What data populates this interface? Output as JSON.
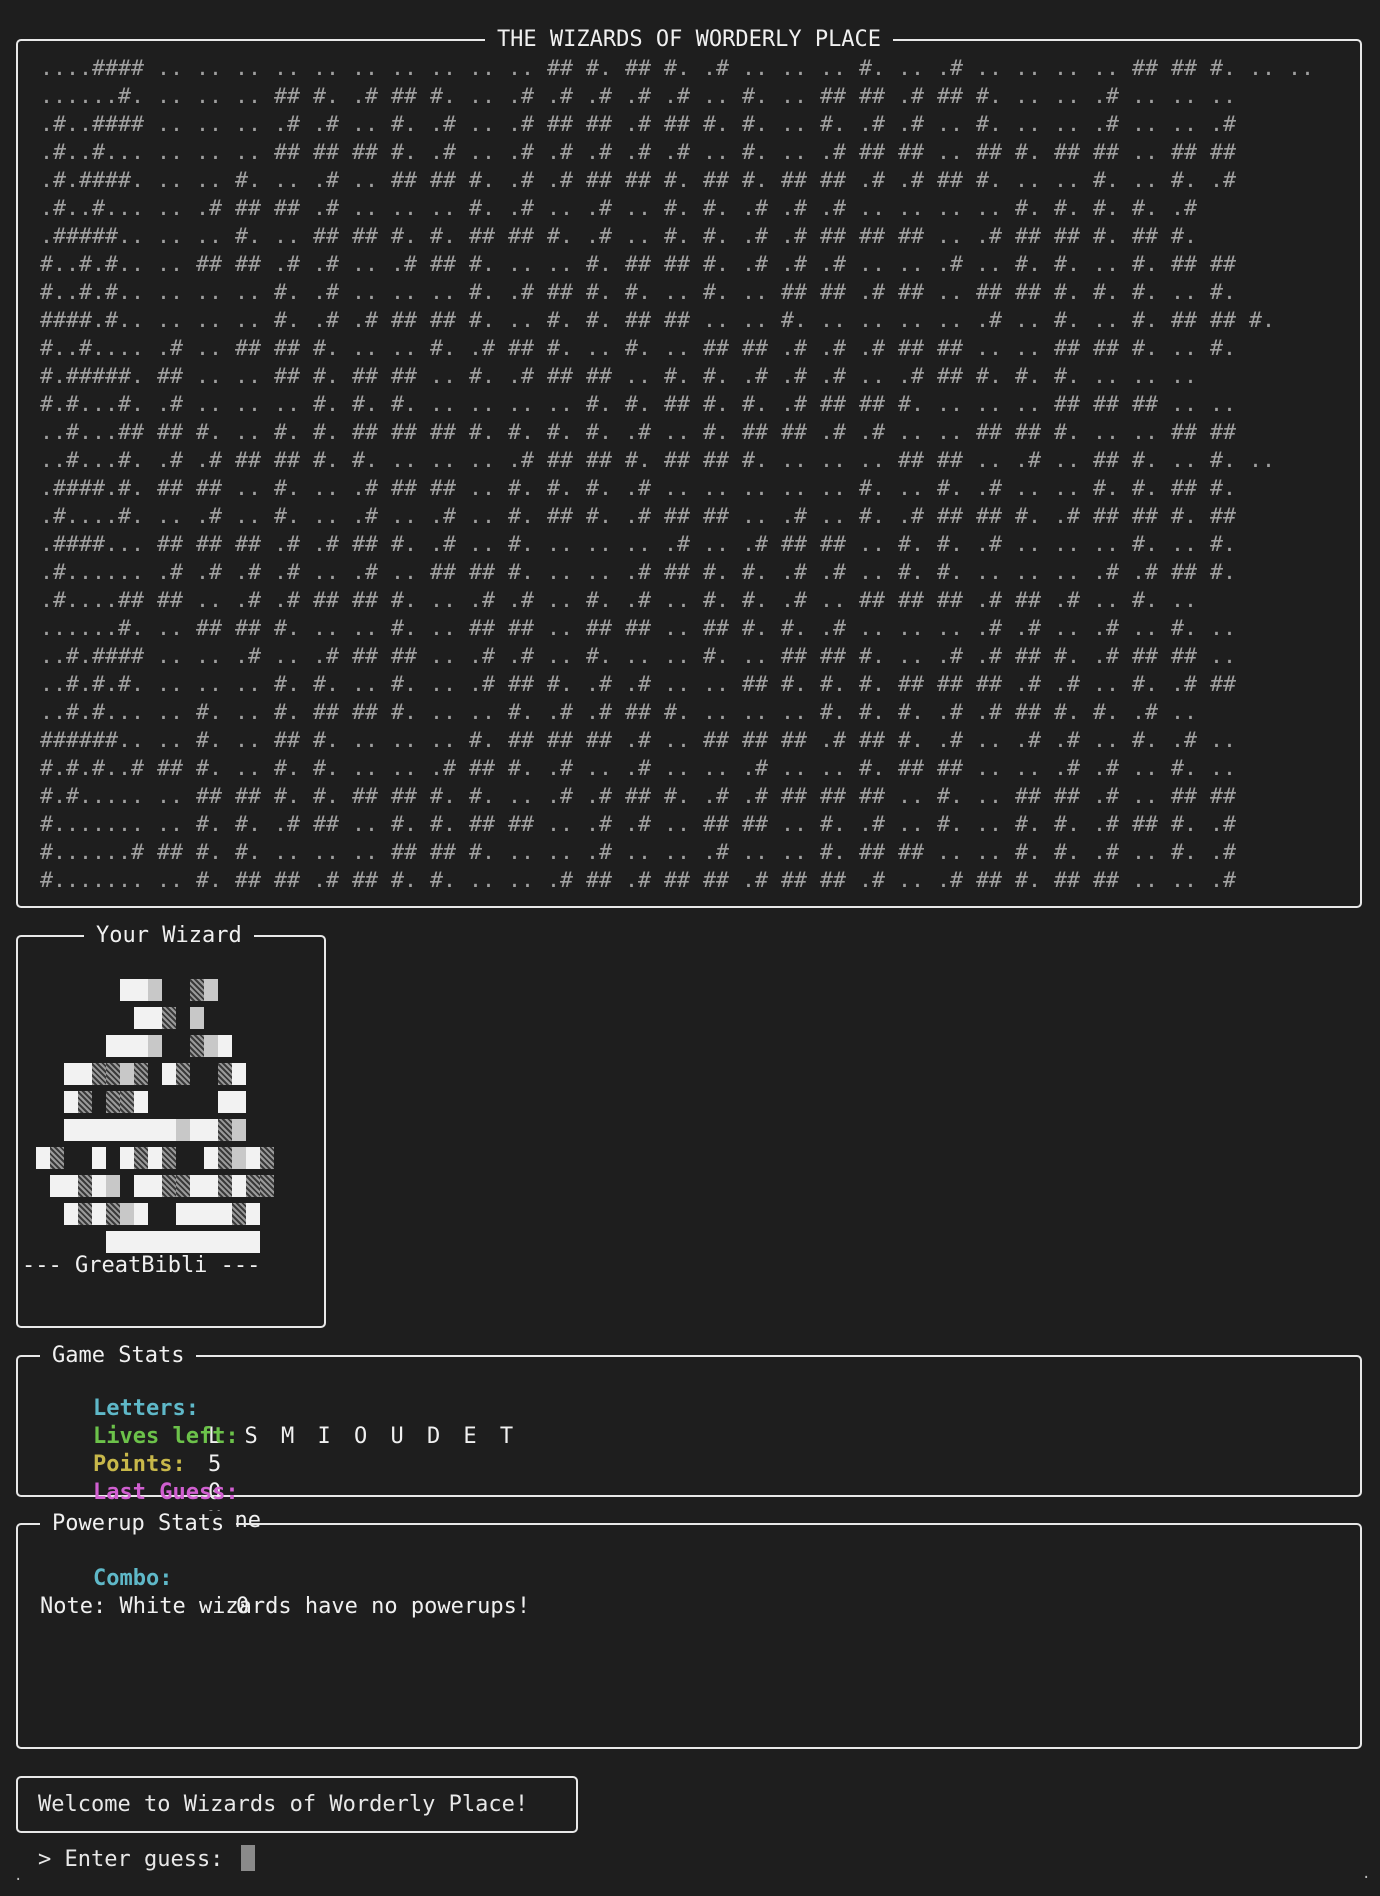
{
  "board": {
    "title": "THE WIZARDS OF WORDERLY PLACE",
    "rows": [
      "....#### .. .. .. .. .. .. .. .. .. .. ## #. ## #. .# .. .. .. #. .. .# .. .. .. .. ## ## #. .. ..",
      "......#. .. .. .. ## #. .# ## #. .. .# .# .# .# .# .. #. .. ## ## .# ## #. .. .. .# .. .. ..",
      ".#..#### .. .. .. .# .# .. #. .# .. .# ## ## .# ## #. #. .. #. .# .# .. #. .. .. .# .. .. .#",
      ".#..#... .. .. .. ## ## ## #. .# .. .# .# .# .# .# .. #. .. .# ## ## .. ## #. ## ## .. ## ##",
      ".#.####. .. .. #. .. .# .. ## ## #. .# .# ## ## #. ## #. ## ## .# .# ## #. .. .. #. .. #. .#",
      ".#..#... .. .# ## ## .# .. .. .. #. .# .. .# .. #. #. .# .# .# .. .. .. .. #. #. #. #. .#",
      ".#####.. .. .. #. .. ## ## #. #. ## ## #. .# .. #. #. .# .# ## ## ## .. .# ## ## #. ## #.",
      "#..#.#.. .. ## ## .# .# .. .# ## #. .. .. #. ## ## #. .# .# .# .. .. .# .. #. #. .. #. ## ##",
      "#..#.#.. .. .. .. #. .# .. .. .. #. .# ## #. #. .. #. .. ## ## .# ## .. ## ## #. #. #. .. #.",
      "####.#.. .. .. .. #. .# .# ## ## #. .. #. #. ## ## .. .. #. .. .. .. .. .# .. #. .. #. ## ## #.",
      "#..#.... .# .. ## ## #. .. .. #. .# ## #. .. #. .. ## ## .# .# .# ## ## .. .. ## ## #. .. #.",
      "#.#####. ## .. .. ## #. ## ## .. #. .# ## ## .. #. #. .# .# .# .. .# ## #. #. #. .. .. ..",
      "#.#...#. .# .. .. .. #. #. #. .. .. .. .. #. #. ## #. #. .# ## ## #. .. .. .. ## ## ## .. ..",
      "..#...## ## #. .. #. #. ## ## ## #. #. #. #. .# .. #. ## ## .# .# .. .. ## ## #. .. .. ## ##",
      "..#...#. .# .# ## ## #. #. .. .. .. .# ## ## #. ## ## #. .. .. .. ## ## .. .# .. ## #. .. #. ..",
      ".####.#. ## ## .. #. .. .# ## ## .. #. #. #. .# .. .. .. .. .. #. .. #. .# .. .. #. #. ## #.",
      ".#....#. .. .# .. #. .. .# .. .# .. #. ## #. .# ## ## .. .# .. #. .# ## ## #. .# ## ## #. ##",
      ".####... ## ## ## .# .# ## #. .# .. #. .. .. .. .# .. .# ## ## .. #. #. .# .. .. .. #. .. #.",
      ".#...... .# .# .# .# .. .# .. ## ## #. .. .. .# ## #. #. .# .# .. #. #. .. .. .. .# .# ## #.",
      ".#....## ## .. .# .# ## ## #. .. .# .# .. #. .# .. #. #. .# .. ## ## ## .# ## .# .. #. ..",
      "......#. .. ## ## #. .. .. #. .. ## ## .. ## ## .. ## #. #. .# .. .. .. .# .# .. .# .. #. ..",
      "..#.#### .. .. .# .. .# ## ## .. .# .# .. #. .. .. #. .. ## ## #. .. .# .# ## #. .# ## ## ..",
      "..#.#.#. .. .. .. #. #. .. #. .. .# ## #. .# .# .. .. ## #. #. #. ## ## ## .# .# .. #. .# ##",
      "..#.#... .. #. .. #. ## ## #. .. .. #. .# .# ## #. .. .. .. #. #. #. .# .# ## #. #. .# ..",
      "######.. .. #. .. ## #. .. .. .. #. ## ## ## .# .. ## ## ## .# ## #. .# .. .# .# .. #. .# ..",
      "#.#.#..# ## #. .. #. #. .. .. .# ## #. .# .. .# .. .. .# .. .. #. ## ## .. .. .# .# .. #. ..",
      "#.#..... .. ## ## #. #. ## ## #. #. .. .# .# ## #. .# .# ## ## ## .. #. .. ## ## .# .. ## ##",
      "#....... .. #. #. .# ## .. #. #. ## ## .. .# .# .. ## ## .. #. .# .. #. .. #. #. .# ## #. .#",
      "#......# ## #. #. .. .. .. ## ## #. .. .. .# .. .. .# .. .. #. ## ## .. .. #. #. .# .. #. .#",
      "#....... .. #. ## ## .# ## #. #. .. .. .# ## .# ## ## .# ## ## .# .. .# ## #. ## ## .. .. .#"
    ]
  },
  "wizard_panel": {
    "title": "Your Wizard",
    "name_line": "--- GreatBibli ---"
  },
  "stats": {
    "title": "Game Stats",
    "letters_label": "Letters:",
    "letters_value": "L S M I O U D E T",
    "lives_label": "Lives left:",
    "lives_value": "5",
    "points_label": "Points:",
    "points_value": "0",
    "last_guess_label": "Last Guess:",
    "last_guess_value": "None",
    "colors": {
      "letters": "#5fb8c8",
      "lives": "#6cc24a",
      "points": "#c8b84a",
      "last_guess": "#d05fd0"
    }
  },
  "powerups": {
    "title": "Powerup Stats",
    "combo_label": "Combo:",
    "combo_value": "0",
    "note": "Note: White wizards have no powerups!",
    "combo_color": "#5fb8c8"
  },
  "message": {
    "text": "Welcome to Wizards of Worderly Place!"
  },
  "prompt": {
    "text": "> Enter guess: ",
    "input_value": ""
  }
}
